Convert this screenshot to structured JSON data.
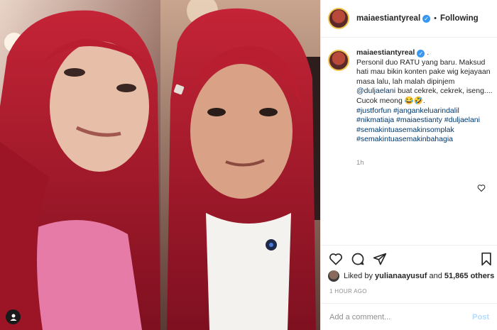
{
  "post": {
    "username": "maiaestiantyreal",
    "follow_status": "Following",
    "separator": "•",
    "caption": {
      "username": "maiaestiantyreal",
      "title_suffix": ".",
      "line1": "Personil duo RATU yang baru. Maksud hati mau bikin konten pake wig kejayaan masa lalu, lah malah dipinjem ",
      "mention": "@duljaelani",
      "line2": " buat cekrek, cekrek, iseng.... Cucok meong ",
      "emojis": "😂🤣",
      "line3": ".",
      "hashtags": [
        "#justforfun",
        "#jangankeluarindalil",
        "#nikmatiaja",
        "#maiaestianty",
        "#duljaelani",
        "#semakintuasemakinsomplak",
        "#semakintuasemakinbahagia"
      ]
    },
    "caption_time": "1h",
    "likes": {
      "liker": "yulianaayusuf",
      "and_text": "and",
      "count_text": "51,865 others",
      "prefix": "Liked by"
    },
    "posted_time": "1 HOUR AGO",
    "comment": {
      "placeholder": "Add a comment...",
      "post_label": "Post"
    }
  },
  "colors": {
    "link": "#00376b",
    "verified": "#3897f0",
    "muted": "#8e8e8e",
    "post_disabled": "#b3dbff",
    "wig_red": "#a8192e"
  }
}
